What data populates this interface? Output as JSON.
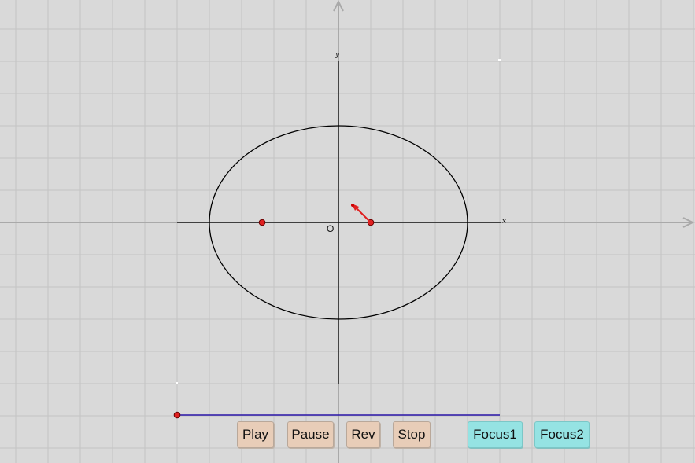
{
  "axes": {
    "x_label": "x",
    "y_label": "y",
    "origin_label": "O"
  },
  "buttons": {
    "play": "Play",
    "pause": "Pause",
    "rev": "Rev",
    "stop": "Stop",
    "focus1": "Focus1",
    "focus2": "Focus2"
  },
  "colors": {
    "background": "#d9d9d9",
    "grid": "#c4c4c4",
    "axis_arrow": "#a9a9a9",
    "ellipse": "#000000",
    "focus_point": "#e02020",
    "slider": "#2a16a8",
    "button_tan": "#e8cdb8",
    "button_cyan": "#95e3e3"
  }
}
